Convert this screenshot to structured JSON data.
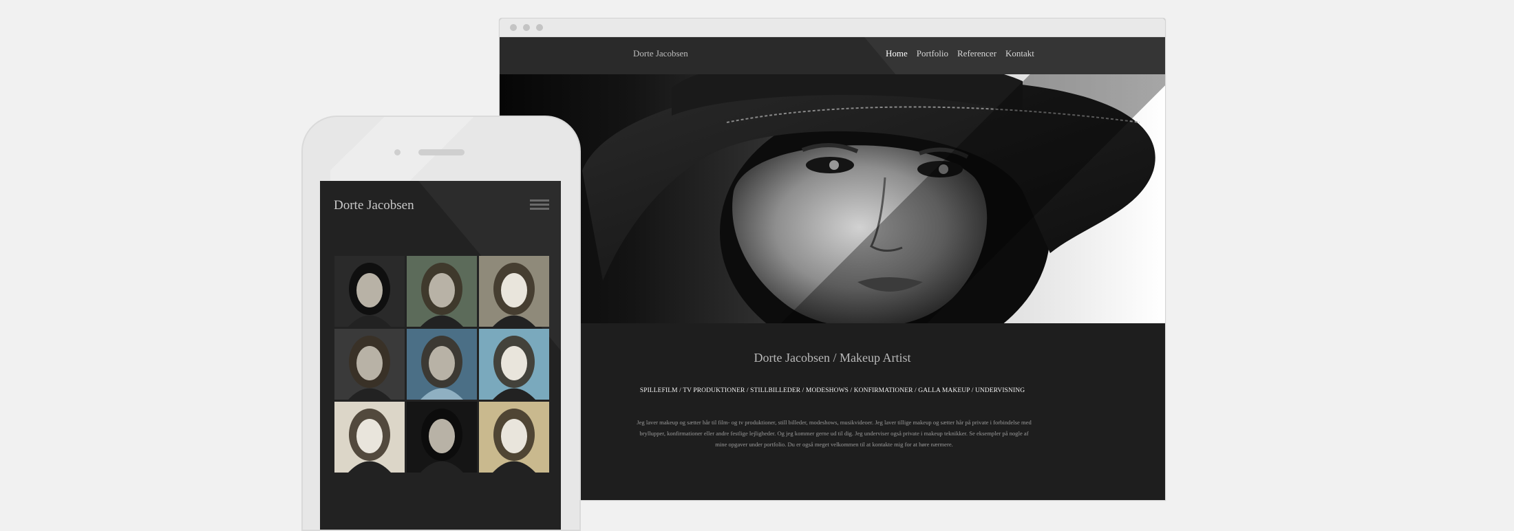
{
  "browser": {
    "window_controls": [
      "close",
      "minimize",
      "maximize"
    ]
  },
  "site": {
    "logo": "Dorte Jacobsen",
    "nav": [
      {
        "label": "Home",
        "active": true
      },
      {
        "label": "Portfolio",
        "active": false
      },
      {
        "label": "Referencer",
        "active": false
      },
      {
        "label": "Kontakt",
        "active": false
      }
    ],
    "hero_alt": "Black and white portrait of a woman wearing a black hat",
    "content": {
      "title": "Dorte Jacobsen / Makeup Artist",
      "tags": "SPILLEFILM / TV PRODUKTIONER / STILLBILLEDER / MODESHOWS / KONFIRMATIONER / GALLA MAKEUP / UNDERVISNING",
      "text": "Jeg laver makeup og sætter hår til film- og tv produktioner, still billeder, modeshows, musikvideoer. Jeg laver tillige makeup og sætter hår på private i forbindelse med bryllupper, konfirmationer eller andre festlige lejligheder. Og jeg kommer gerne ud til dig. Jeg underviser også private i makeup teknikker. Se eksempler på nogle af mine opgaver under portfolio. Du er også meget velkommen til at kontakte mig for at høre nærmere."
    }
  },
  "mobile": {
    "title": "Dorte Jacobsen",
    "menu_icon": "hamburger-menu-icon",
    "thumbnails": [
      {
        "name": "portrait-1",
        "tone": "#2a2a2a"
      },
      {
        "name": "portrait-2",
        "tone": "#5c6b5a"
      },
      {
        "name": "portrait-3",
        "tone": "#8f8a7a"
      },
      {
        "name": "portrait-4",
        "tone": "#3a3a3a"
      },
      {
        "name": "portrait-5",
        "tone": "#4b6f86"
      },
      {
        "name": "portrait-6",
        "tone": "#7aa9bd"
      },
      {
        "name": "portrait-7",
        "tone": "#dcd6c8"
      },
      {
        "name": "portrait-8",
        "tone": "#151515"
      },
      {
        "name": "portrait-9",
        "tone": "#c9b98e"
      }
    ]
  },
  "colors": {
    "page_bg": "#f1f1f1",
    "site_bg": "#1e1e1e",
    "header_bg": "#2a2a2a"
  }
}
